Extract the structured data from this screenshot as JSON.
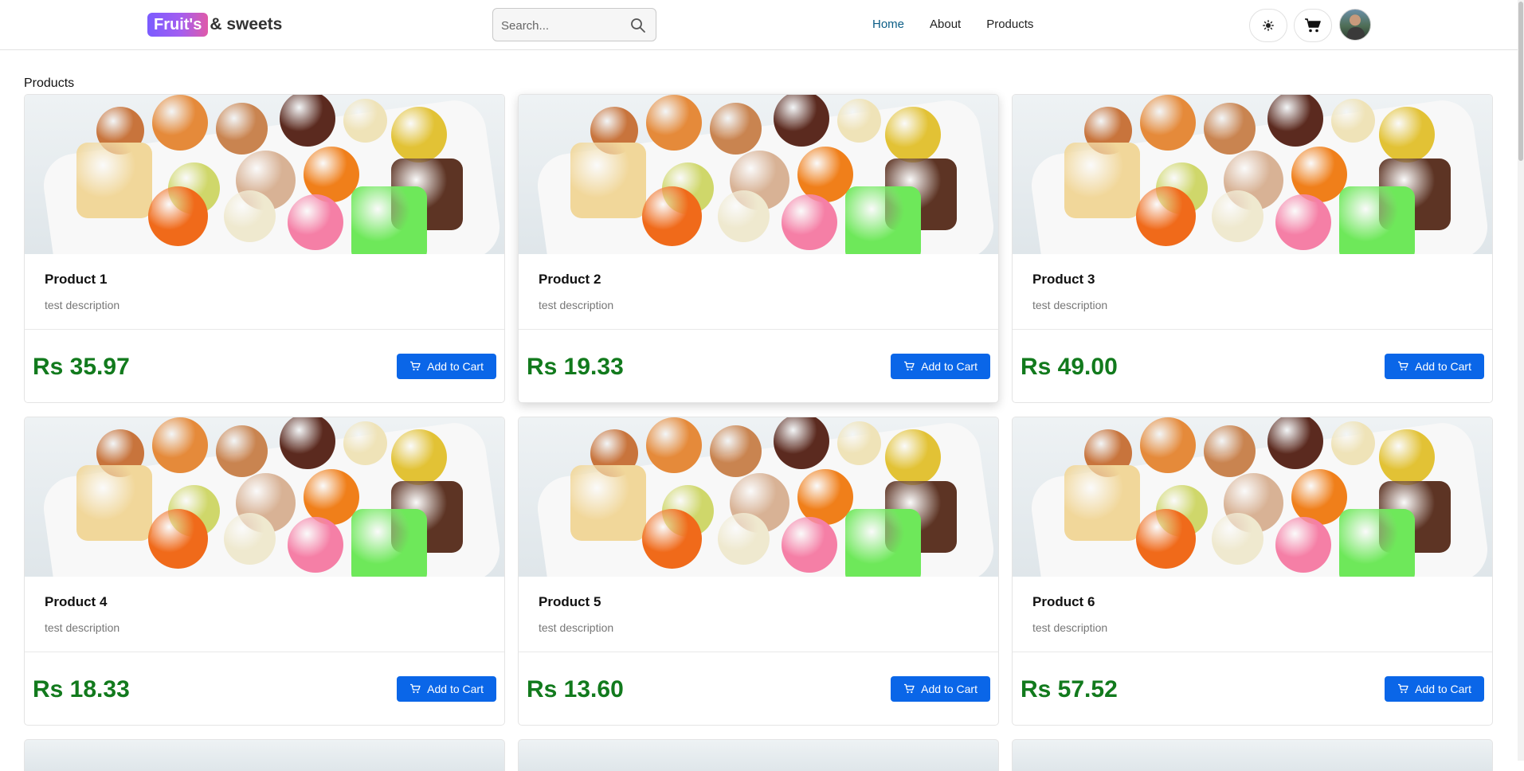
{
  "header": {
    "logo_badge": "Fruit's",
    "logo_text": "& sweets",
    "search_placeholder": "Search...",
    "nav": [
      {
        "label": "Home",
        "active": true
      },
      {
        "label": "About",
        "active": false
      },
      {
        "label": "Products",
        "active": false
      }
    ],
    "theme_icon": "sun-icon",
    "cart_icon": "cart-icon"
  },
  "main": {
    "section_title": "Products",
    "add_to_cart_label": "Add to Cart",
    "products": [
      {
        "title": "Product 1",
        "description": "test description",
        "price": "Rs 35.97"
      },
      {
        "title": "Product 2",
        "description": "test description",
        "price": "Rs 19.33"
      },
      {
        "title": "Product 3",
        "description": "test description",
        "price": "Rs 49.00"
      },
      {
        "title": "Product 4",
        "description": "test description",
        "price": "Rs 18.33"
      },
      {
        "title": "Product 5",
        "description": "test description",
        "price": "Rs 13.60"
      },
      {
        "title": "Product 6",
        "description": "test description",
        "price": "Rs 57.52"
      }
    ]
  },
  "colors": {
    "price": "#127a1d",
    "button": "#0a66e8",
    "active_nav": "#0b5d86"
  }
}
